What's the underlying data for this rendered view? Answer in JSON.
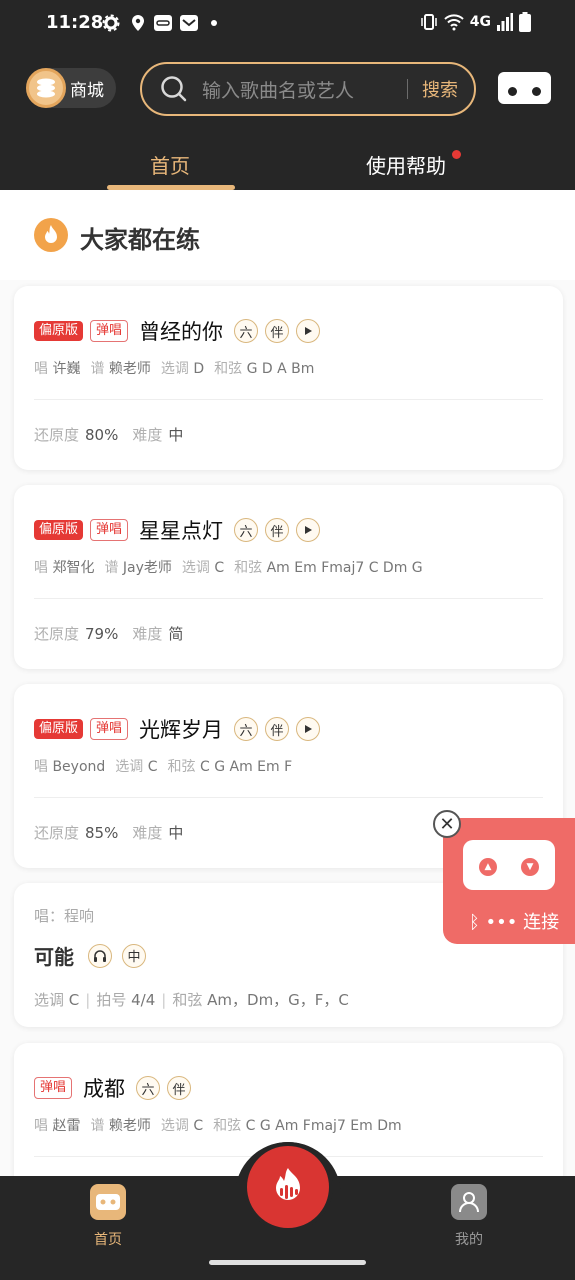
{
  "status_bar": {
    "time": "11:28",
    "network": "4G",
    "icons": [
      "gear-icon",
      "location-icon",
      "link-icon",
      "mail-icon",
      "dot-icon",
      "vibrate-icon",
      "wifi-icon",
      "signal-icon",
      "battery-icon"
    ]
  },
  "header": {
    "mall_label": "商城",
    "search_placeholder": "输入歌曲名或艺人",
    "search_button": "搜索",
    "accent_color": "#e8b77a"
  },
  "tabs": [
    {
      "label": "首页",
      "active": true
    },
    {
      "label": "使用帮助",
      "active": false,
      "has_dot": true
    }
  ],
  "section": {
    "title": "大家都在练"
  },
  "songs": [
    {
      "badges": [
        "偏原版",
        "弹唱"
      ],
      "name": "曾经的你",
      "tags": [
        "六",
        "伴"
      ],
      "singer_label": "唱",
      "singer": "许巍",
      "score_label": "谱",
      "score": "赖老师",
      "key_label": "选调",
      "key": "D",
      "chords_label": "和弦",
      "chords": "G D A Bm",
      "fidelity_label": "还原度",
      "fidelity": "80%",
      "difficulty_label": "难度",
      "difficulty": "中"
    },
    {
      "badges": [
        "偏原版",
        "弹唱"
      ],
      "name": "星星点灯",
      "tags": [
        "六",
        "伴"
      ],
      "singer_label": "唱",
      "singer": "郑智化",
      "score_label": "谱",
      "score": "Jay老师",
      "key_label": "选调",
      "key": "C",
      "chords_label": "和弦",
      "chords": "Am Em Fmaj7 C Dm G",
      "fidelity_label": "还原度",
      "fidelity": "79%",
      "difficulty_label": "难度",
      "difficulty": "简"
    },
    {
      "badges": [
        "偏原版",
        "弹唱"
      ],
      "name": "光辉岁月",
      "tags": [
        "六",
        "伴"
      ],
      "singer_label": "唱",
      "singer": "Beyond",
      "key_label": "选调",
      "key": "C",
      "chords_label": "和弦",
      "chords": "C G Am Em F",
      "fidelity_label": "还原度",
      "fidelity": "85%",
      "difficulty_label": "难度",
      "difficulty": "中"
    }
  ],
  "song4": {
    "singer_text": "唱：程响",
    "name": "可能",
    "tag": "中",
    "key_label": "选调",
    "key": "C",
    "beat_label": "拍号",
    "beat": "4/4",
    "chords_label": "和弦",
    "chords": "Am，Dm，G，F，C"
  },
  "song5": {
    "badge": "弹唱",
    "name": "成都",
    "tags": [
      "六",
      "伴"
    ],
    "singer_label": "唱",
    "singer": "赵雷",
    "score_label": "谱",
    "score": "赖老师",
    "key_label": "选调",
    "key": "C",
    "chords_label": "和弦",
    "chords": "C G Am Fmaj7 Em Dm"
  },
  "float_connect": {
    "label": "连接",
    "icons": [
      "bluetooth-icon",
      "close-icon"
    ]
  },
  "bottom_nav": {
    "home_label": "首页",
    "mine_label": "我的"
  }
}
